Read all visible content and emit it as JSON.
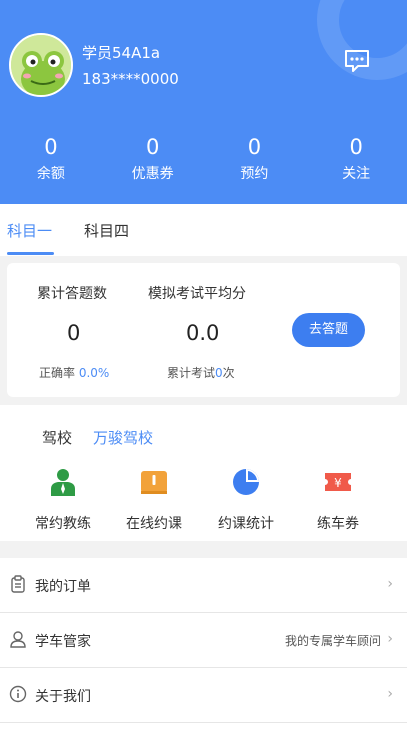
{
  "profile": {
    "username": "学员54A1a",
    "phone": "183****0000"
  },
  "stats": [
    {
      "value": "0",
      "label": "余额"
    },
    {
      "value": "0",
      "label": "优惠券"
    },
    {
      "value": "0",
      "label": "预约"
    },
    {
      "value": "0",
      "label": "关注"
    }
  ],
  "tabs": [
    {
      "label": "科目一",
      "active": true
    },
    {
      "label": "科目四",
      "active": false
    }
  ],
  "summary": {
    "answered_label": "累计答题数",
    "answered_value": "0",
    "accuracy_label": "正确率",
    "accuracy_value": "0.0%",
    "exam_avg_label": "模拟考试平均分",
    "exam_avg_value": "0.0",
    "exam_count_prefix": "累计考试",
    "exam_count_value": "0",
    "exam_count_suffix": "次",
    "go_button": "去答题"
  },
  "school": {
    "label": "驾校",
    "name": "万骏驾校",
    "features": [
      {
        "label": "常约教练",
        "icon": "coach-icon",
        "color": "#2e9b45"
      },
      {
        "label": "在线约课",
        "icon": "book-icon",
        "color": "#f2a23a"
      },
      {
        "label": "约课统计",
        "icon": "pie-chart-icon",
        "color": "#3d7ef0"
      },
      {
        "label": "练车券",
        "icon": "ticket-icon",
        "color": "#f05a4a"
      }
    ]
  },
  "menu": [
    {
      "label": "我的订单",
      "icon": "clipboard-icon",
      "sub": ""
    },
    {
      "label": "学车管家",
      "icon": "user-icon",
      "sub": "我的专属学车顾问"
    },
    {
      "label": "关于我们",
      "icon": "info-icon",
      "sub": ""
    }
  ],
  "colors": {
    "primary": "#4c8cf5",
    "button": "#3d7ef0"
  }
}
